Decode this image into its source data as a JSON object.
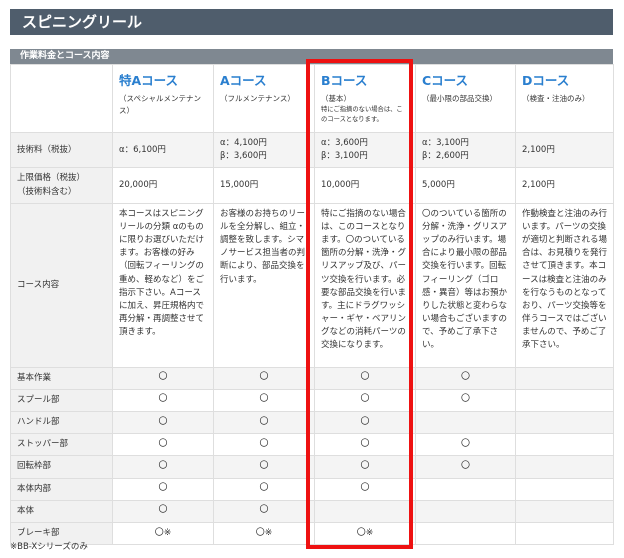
{
  "title": "スピニングリール",
  "section": "作業料金とコース内容",
  "courses": [
    {
      "name": "特Aコース",
      "sub": "（スペシャルメンテナンス）"
    },
    {
      "name": "Aコース",
      "sub": "（フルメンテナンス）"
    },
    {
      "name": "Bコース",
      "sub": "（基本）",
      "note": "特にご指摘のない場合は、このコースとなります。"
    },
    {
      "name": "Cコース",
      "sub": "（最小限の部品交換）"
    },
    {
      "name": "Dコース",
      "sub": "（検査・注油のみ）"
    }
  ],
  "rows": {
    "fee_label": "技術料（税抜）",
    "fee": [
      "α：6,100円",
      "α：4,100円\nβ：3,600円",
      "α：3,600円\nβ：3,100円",
      "α：3,100円\nβ：2,600円",
      "2,100円"
    ],
    "max_label": "上限価格（税抜）\n（技術料含む）",
    "max": [
      "20,000円",
      "15,000円",
      "10,000円",
      "5,000円",
      "2,100円"
    ],
    "content_label": "コース内容",
    "content": [
      "本コースはスピニングリールの分類 αのものに限りお選びいただけます。お客様の好み（回転フィーリングの重め、軽めなど）をご指示下さい。Aコースに加え、昇圧規格内で再分解・再調整させて頂きます。",
      "お客様のお持ちのリールを全分解し、組立・調整を致します。シマノサービス担当者の判断により、部品交換を行います。",
      "特にご指摘のない場合は、このコースとなります。〇のついている箇所の分解・洗浄・グリスアップ及び、パーツ交換を行います。必要な部品交換を行います。主にドラグワッシャー・ギヤ・ベアリングなどの消耗パーツの交換になります。",
      "〇のついている箇所の分解・洗浄・グリスアップのみ行います。場合により最小限の部品交換を行います。回転フィーリング（ゴロ感・異音）等はお預かりした状態と変わらない場合もございますので、予めご了承下さい。",
      "作動検査と注油のみ行います。パーツの交換が適切と判断される場合は、お見積りを発行させて頂きます。本コースは検査と注油のみを行なうものとなっており、パーツ交換等を伴うコースではございませんので、予めご了承下さい。"
    ]
  },
  "items": [
    {
      "label": "基本作業",
      "marks": [
        "〇",
        "〇",
        "〇",
        "〇",
        ""
      ]
    },
    {
      "label": "スプール部",
      "marks": [
        "〇",
        "〇",
        "〇",
        "〇",
        ""
      ]
    },
    {
      "label": "ハンドル部",
      "marks": [
        "〇",
        "〇",
        "〇",
        "",
        ""
      ]
    },
    {
      "label": "ストッパー部",
      "marks": [
        "〇",
        "〇",
        "〇",
        "〇",
        ""
      ]
    },
    {
      "label": "回転枠部",
      "marks": [
        "〇",
        "〇",
        "〇",
        "〇",
        ""
      ]
    },
    {
      "label": "本体内部",
      "marks": [
        "〇",
        "〇",
        "〇",
        "",
        ""
      ]
    },
    {
      "label": "本体",
      "marks": [
        "〇",
        "〇",
        "",
        "",
        ""
      ]
    },
    {
      "label": "ブレーキ部",
      "marks": [
        "〇※",
        "〇※",
        "〇※",
        "",
        ""
      ]
    }
  ],
  "footnote": "※BB-Xシリーズのみ",
  "colors": {
    "title_bg": "#4f5d6c",
    "section_bg": "#7f8891",
    "course_name": "#2a7fcf",
    "highlight": "#ee1111"
  }
}
